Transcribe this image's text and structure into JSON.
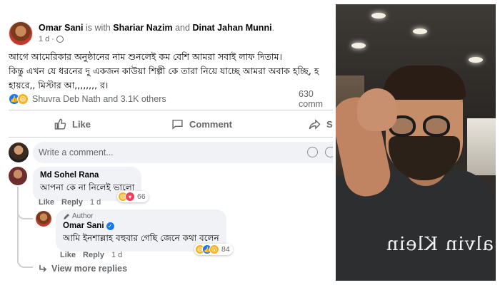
{
  "post": {
    "author": "Omar Sani",
    "with_text": "is with",
    "tagged_1": "Shariar Nazim",
    "and_text": "and",
    "tagged_2": "Dinat Jahan Munni",
    "period": ".",
    "time": "1 d",
    "time_sep": "·",
    "body_lines": [
      "আগে আমেরিকার অনুষ্ঠানের নাম শুনলেই কম বেশি আমরা সবাই লাফ দিতাম।",
      "কিন্তু এখন যে ধরনের দু একজন কাউয়া শিল্পী কে তারা নিয়ে যাচ্ছে আমরা অবাক হচ্ছি, হ",
      "হায়রে,, মিস্টার আ,,,,,,,, র।"
    ],
    "reactions_names": "Shuvra Deb Nath and 3.1K others",
    "comments_count": "630 comm"
  },
  "actions": {
    "like": "Like",
    "comment": "Comment",
    "share": "Sl"
  },
  "write_comment": {
    "placeholder": "Write a comment..."
  },
  "comments": [
    {
      "name": "Md Sohel Rana",
      "text": "আপনা কে না নিলেই ভালো",
      "like": "Like",
      "reply": "Reply",
      "time": "1 d",
      "reaction_count": "66"
    },
    {
      "author_tag": "Author",
      "name": "Omar Sani",
      "text": "আমি ইনশাল্লাহ বহুবার গেছি জেনে কথা বলেন",
      "like": "Like",
      "reply": "Reply",
      "time": "1 d",
      "reaction_count": "84"
    }
  ],
  "view_more": "View more replies",
  "photo": {
    "shirt_text": "Calvin Klein"
  },
  "colors": {
    "link_blue": "#1877f2",
    "muted_gray": "#65676b",
    "bubble_bg": "#f0f2f5"
  }
}
